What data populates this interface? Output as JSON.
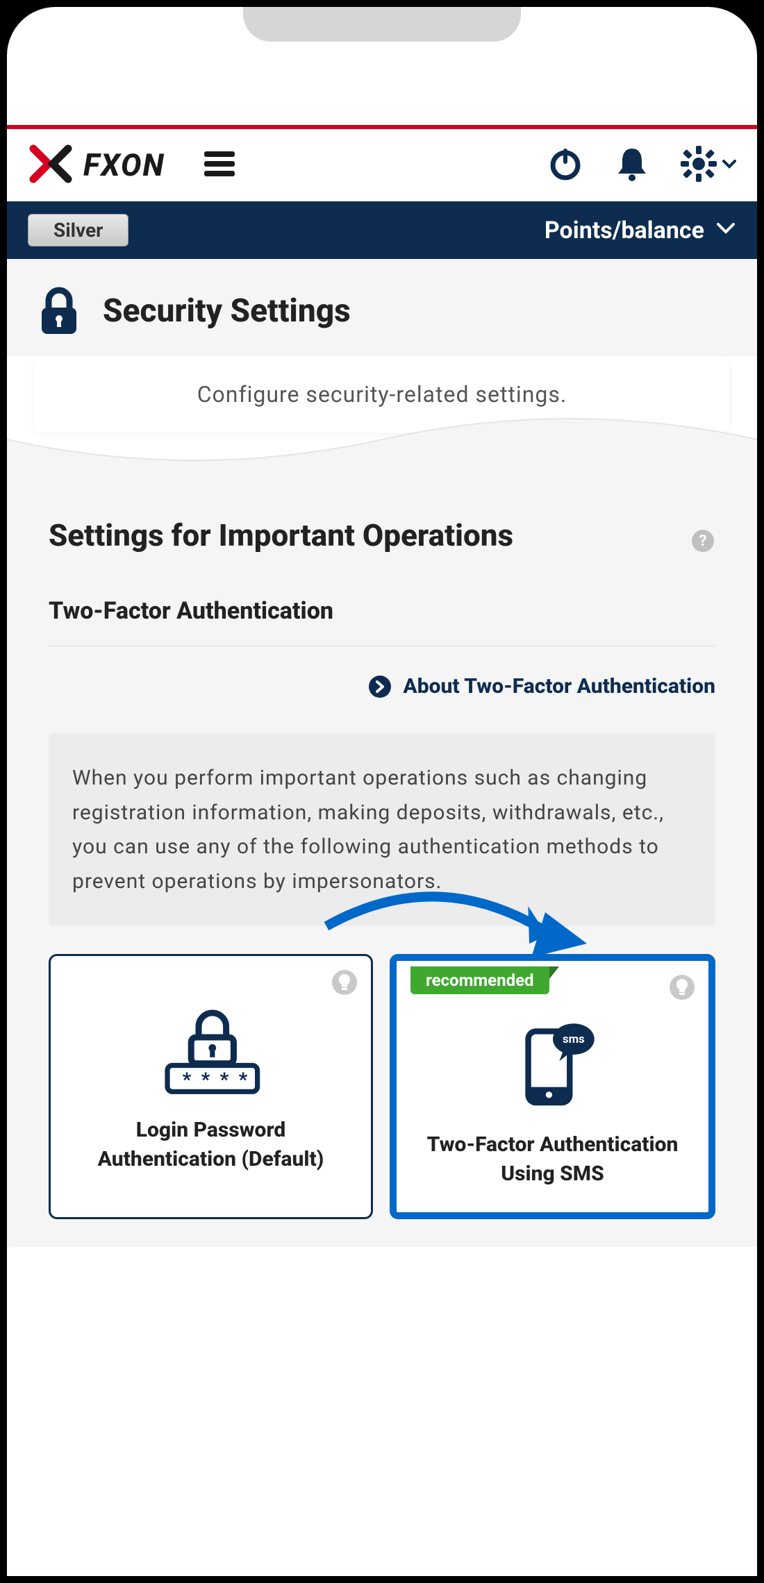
{
  "header": {
    "brand": "FXON",
    "tier_badge": "Silver",
    "points_label": "Points/balance"
  },
  "page": {
    "title": "Security Settings",
    "description": "Configure security-related settings."
  },
  "section": {
    "title": "Settings for Important Operations",
    "subsection": "Two-Factor Authentication",
    "about_link": "About Two-Factor Authentication",
    "info_text": "When you perform important operations such as changing registration information, making deposits, withdrawals, etc., you can use any of the following authentication methods to prevent operations by impersonators."
  },
  "auth_options": {
    "recommended_label": "recommended",
    "option1": "Login Password Authentication (Default)",
    "option2": "Two-Factor Authentication Using SMS",
    "sms_badge": "sms"
  }
}
